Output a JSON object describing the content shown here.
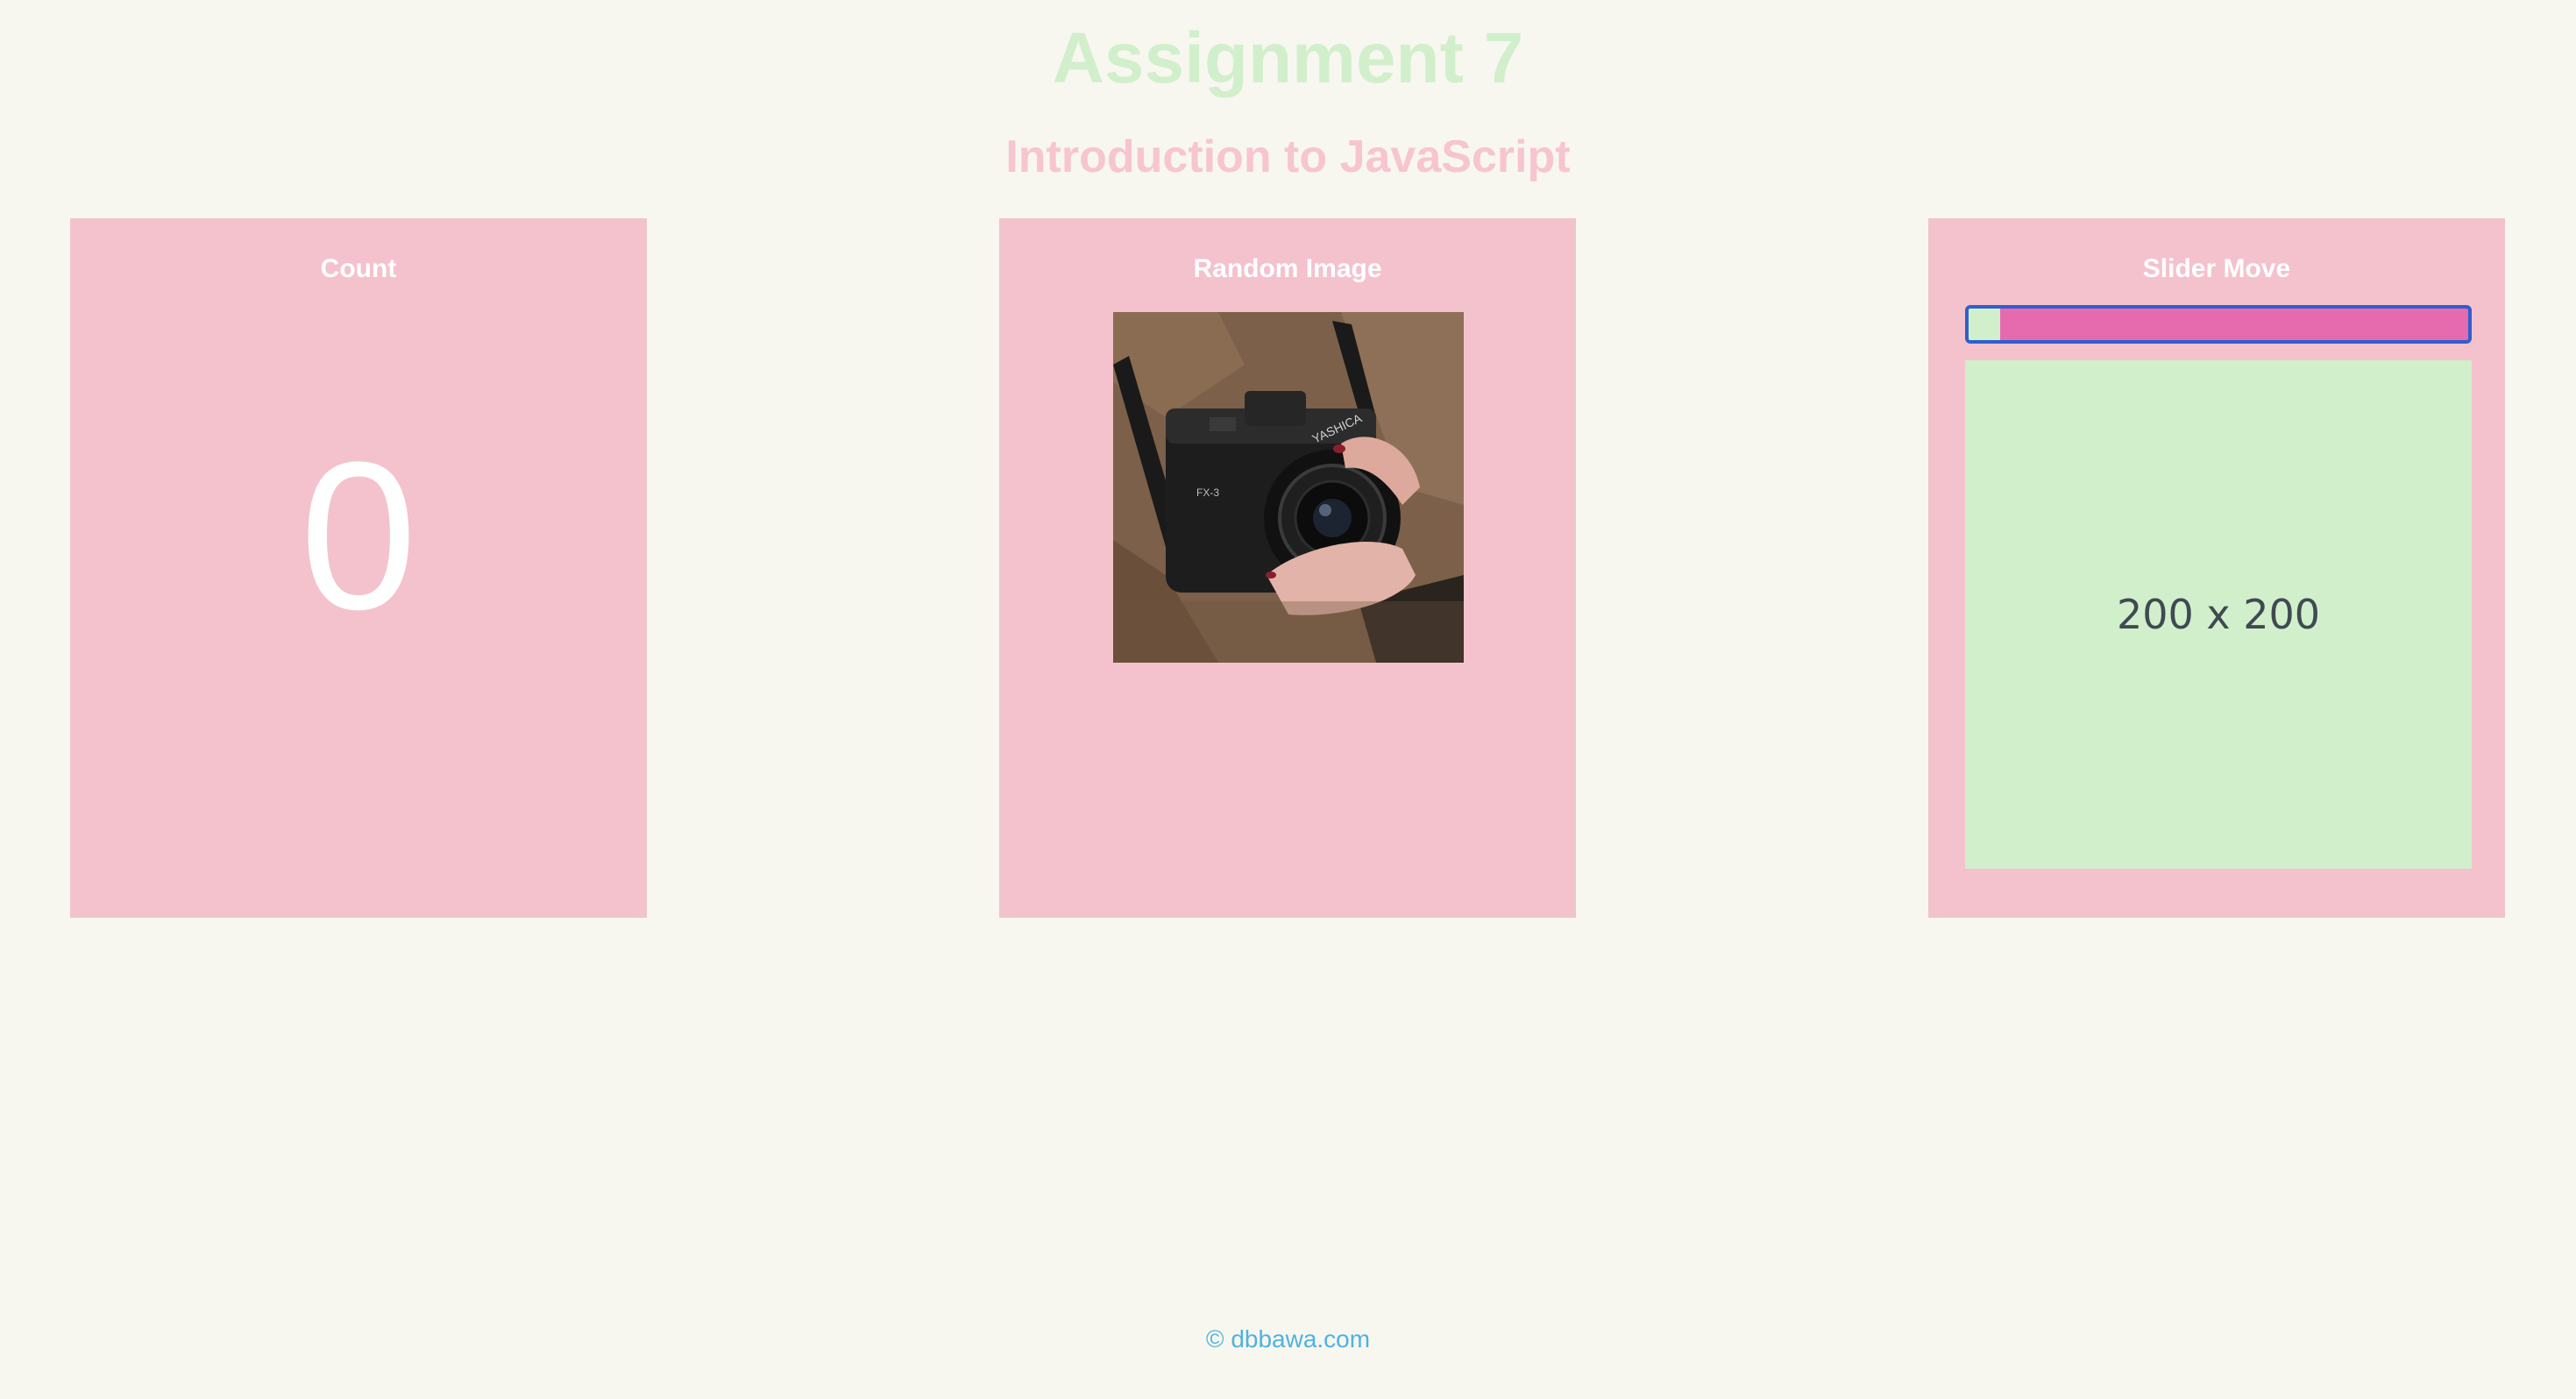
{
  "header": {
    "title": "Assignment 7",
    "subtitle": "Introduction to JavaScript"
  },
  "cards": {
    "count": {
      "title": "Count",
      "value": "0"
    },
    "random_image": {
      "title": "Random Image",
      "image_icon": "camera-photo-icon"
    },
    "slider": {
      "title": "Slider Move",
      "slider_value_fraction": 0.06,
      "box_label": "200 x 200"
    }
  },
  "footer": {
    "copyright": "© dbbawa.com"
  },
  "colors": {
    "background": "#f7f7f0",
    "title": "#d2efcc",
    "subtitle": "#f7c5cf",
    "card": "#f4c2cc",
    "slider_track": "#e66aae",
    "slider_border": "#2e5fcf",
    "slider_box": "#d2efcc",
    "footer_link": "#4fb3de"
  }
}
